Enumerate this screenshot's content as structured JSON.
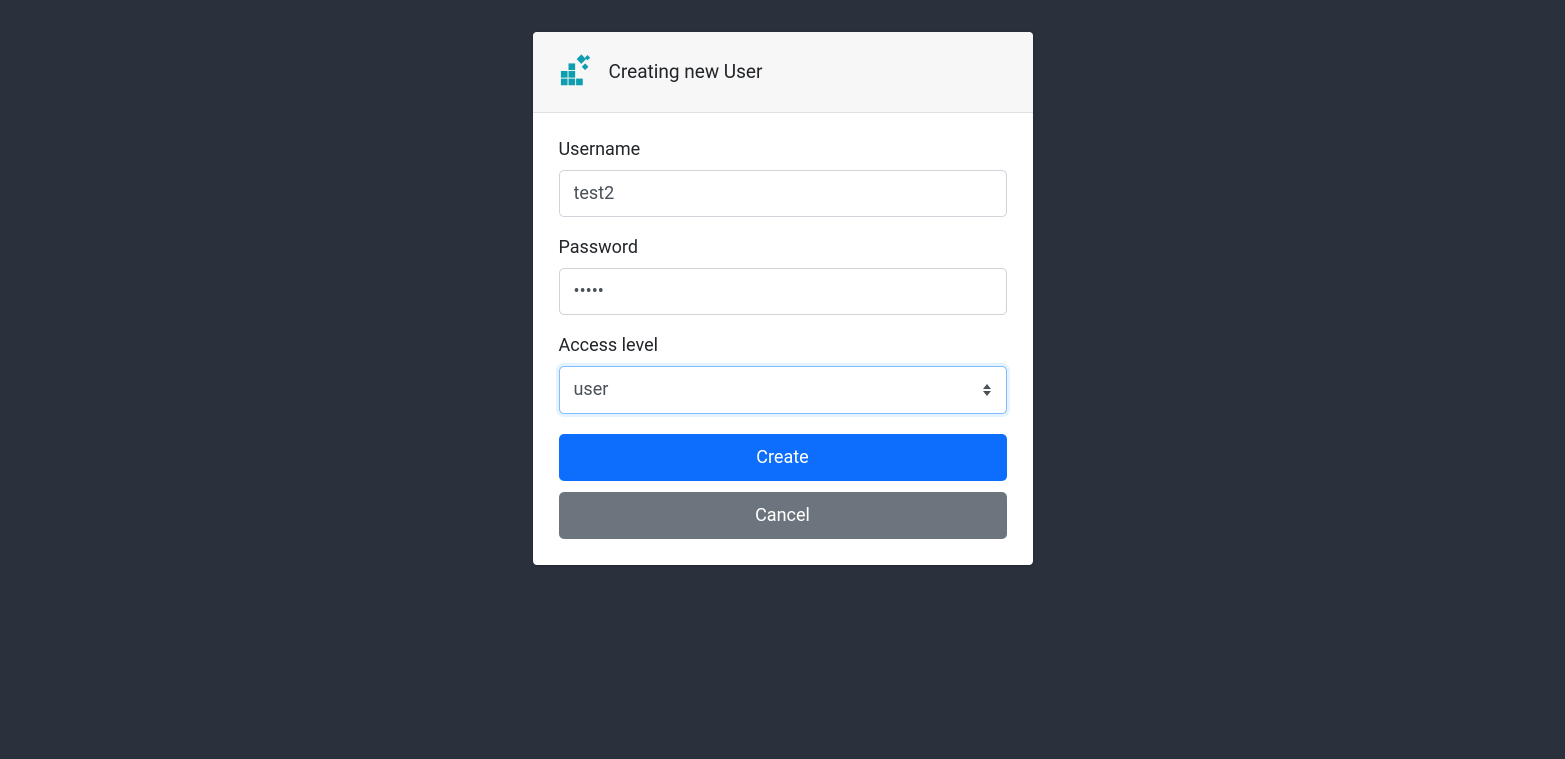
{
  "header": {
    "title": "Creating new User",
    "logo_color": "#0f9eb0"
  },
  "form": {
    "username": {
      "label": "Username",
      "value": "test2"
    },
    "password": {
      "label": "Password",
      "value": "•••••"
    },
    "access_level": {
      "label": "Access level",
      "selected": "user"
    }
  },
  "buttons": {
    "create": "Create",
    "cancel": "Cancel"
  }
}
